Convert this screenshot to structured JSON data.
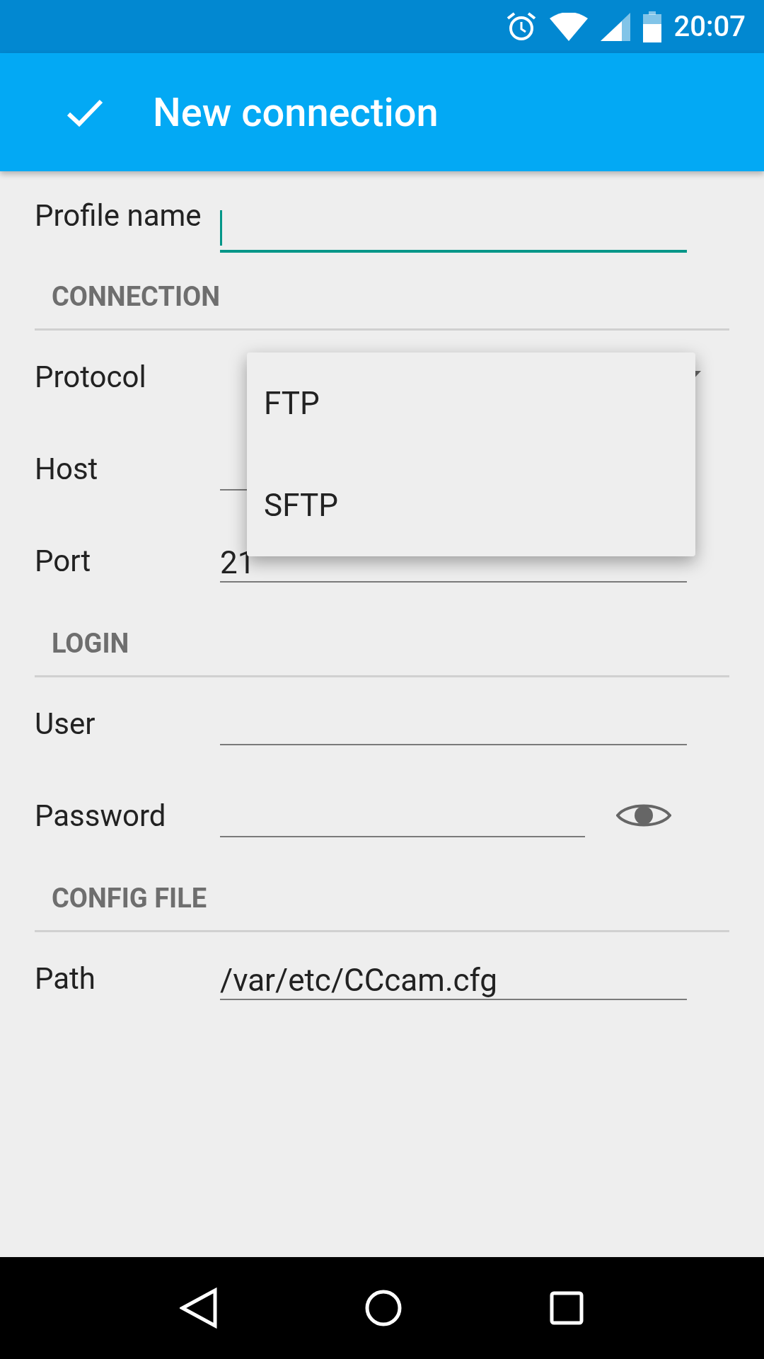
{
  "status_bar": {
    "time": "20:07"
  },
  "app_bar": {
    "title": "New connection"
  },
  "profile": {
    "label": "Profile name",
    "focused": true
  },
  "sections": [
    {
      "title": "CONNECTION",
      "fields": [
        {
          "kind": "dropdown",
          "label": "Protocol"
        },
        {
          "kind": "text",
          "label": "Host"
        },
        {
          "kind": "text",
          "label": "Port",
          "value": "21"
        }
      ]
    },
    {
      "title": "LOGIN",
      "fields": [
        {
          "kind": "text",
          "label": "User"
        },
        {
          "kind": "password",
          "label": "Password"
        }
      ]
    },
    {
      "title": "CONFIG FILE",
      "fields": [
        {
          "kind": "text",
          "label": "Path",
          "value": "/var/etc/CCcam.cfg"
        }
      ]
    }
  ],
  "dropdown_menu": {
    "options": [
      {
        "label": "FTP"
      },
      {
        "label": "SFTP"
      }
    ]
  }
}
